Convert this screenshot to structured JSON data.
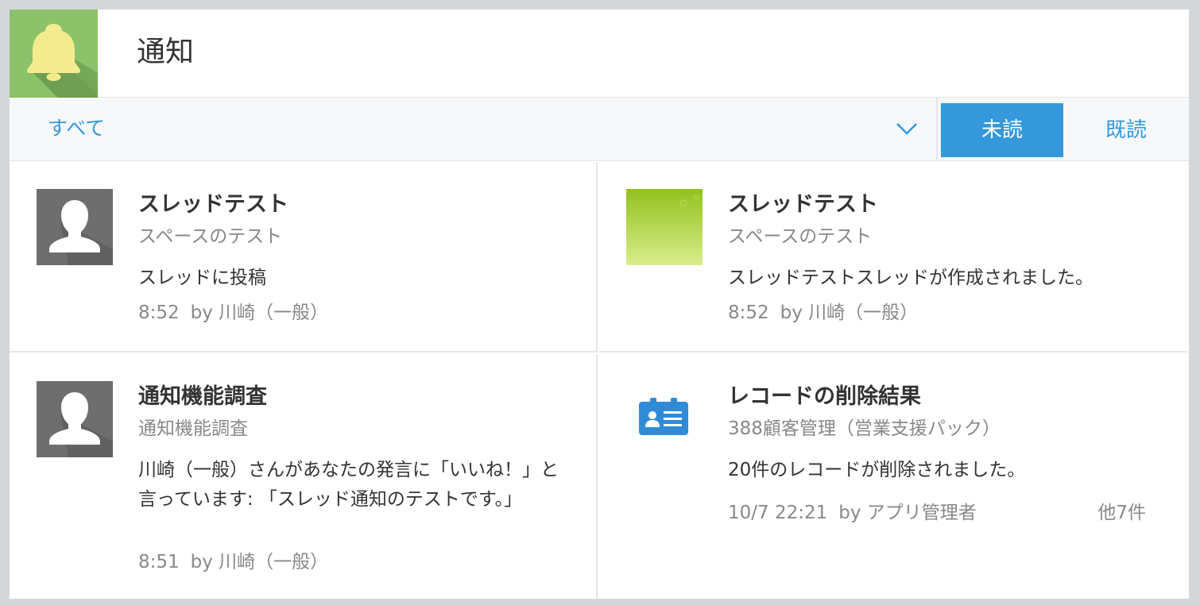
{
  "header": {
    "title": "通知",
    "icon": "bell-icon",
    "tile_color": "#8cc26a"
  },
  "filter": {
    "selected": "すべて",
    "tabs": [
      {
        "label": "未読",
        "active": true
      },
      {
        "label": "既読",
        "active": false
      }
    ]
  },
  "colors": {
    "accent": "#3498db",
    "muted_text": "#888888"
  },
  "notifications": [
    {
      "avatar": "user-silhouette-icon",
      "title": "スレッドテスト",
      "space": "スペースのテスト",
      "message": "スレッドに投稿",
      "time": "8:52",
      "by": "by 川崎（一般）"
    },
    {
      "avatar": "space-cover-image",
      "title": "スレッドテスト",
      "space": "スペースのテスト",
      "message": "スレッドテストスレッドが作成されました。",
      "time": "8:52",
      "by": "by 川崎（一般）"
    },
    {
      "avatar": "user-silhouette-icon",
      "title": "通知機能調査",
      "space": "通知機能調査",
      "message": "川崎（一般）さんがあなたの発言に「いいね！」と言っています: 「スレッド通知のテストです。」",
      "time": "8:51",
      "by": "by 川崎（一般）"
    },
    {
      "avatar": "contact-card-icon",
      "title": "レコードの削除結果",
      "space": "388顧客管理（営業支援パック）",
      "message": "20件のレコードが削除されました。",
      "time": "10/7 22:21",
      "by": "by アプリ管理者",
      "more": "他7件"
    }
  ]
}
